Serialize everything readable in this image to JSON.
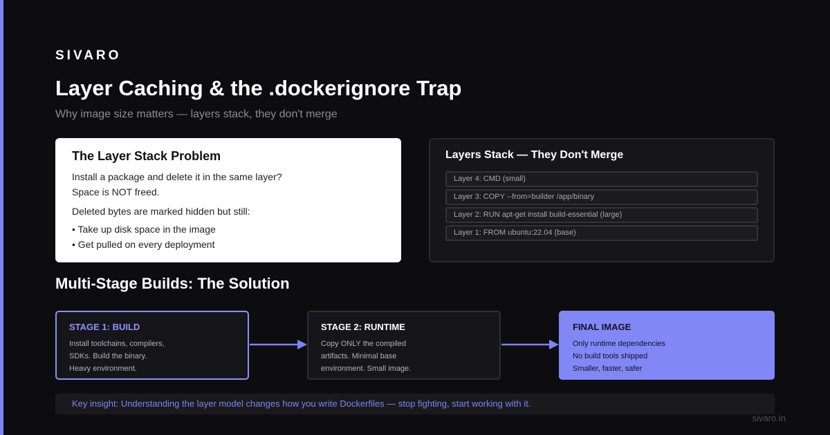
{
  "brand": "SIVARO",
  "title": "Layer Caching & the .dockerignore Trap",
  "subtitle": "Why image size matters — layers stack, they don't merge",
  "problem": {
    "heading": "The Layer Stack Problem",
    "line1": "Install a package and delete it in the same layer?",
    "line2": "Space is NOT freed.",
    "line3": "Deleted bytes are marked hidden but still:",
    "bullets": [
      "• Take up disk space in the image",
      "• Get pulled on every deployment"
    ]
  },
  "stack": {
    "heading": "Layers Stack — They Don't Merge",
    "layers": [
      "Layer 4: CMD (small)",
      "Layer 3: COPY --from=builder /app/binary",
      "Layer 2: RUN apt-get install build-essential (large)",
      "Layer 1: FROM ubuntu:22.04 (base)"
    ]
  },
  "solution_title": "Multi-Stage Builds: The Solution",
  "stages": [
    {
      "title": "STAGE 1: BUILD",
      "lines": [
        "Install toolchains, compilers,",
        "SDKs. Build the binary.",
        "Heavy environment."
      ]
    },
    {
      "title": "STAGE 2: RUNTIME",
      "lines": [
        "Copy ONLY the compiled",
        "artifacts. Minimal base",
        "environment. Small image."
      ]
    },
    {
      "title": "FINAL IMAGE",
      "lines": [
        "Only runtime dependencies",
        "No build tools shipped",
        "Smaller, faster, safer"
      ]
    }
  ],
  "insight": "Key insight: Understanding the layer model changes how you write Dockerfiles — stop fighting, start working with it.",
  "footer": "sivaro.in",
  "colors": {
    "accent": "#7c84f5",
    "final": "#8188f6",
    "background": "#0d0d0f"
  }
}
